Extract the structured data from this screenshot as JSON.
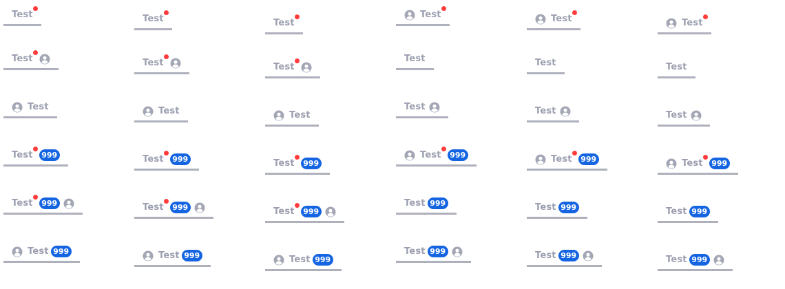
{
  "theme": {
    "inactive_color": "#9b9faf",
    "underline_color": "#aeb0bc",
    "badge_color": "#1565e2",
    "dot_color": "#ff3b3b"
  },
  "tabs": [
    {
      "label": "Test",
      "dot": true
    },
    {
      "label": "Test",
      "dot": true
    },
    {
      "label": "Test",
      "dot": true
    },
    {
      "label": "Test",
      "dot": true,
      "icon": "user-icon",
      "icon_pos": "before"
    },
    {
      "label": "Test",
      "dot": true,
      "icon": "user-icon",
      "icon_pos": "before"
    },
    {
      "label": "Test",
      "dot": true,
      "icon": "user-icon",
      "icon_pos": "before"
    },
    {
      "label": "Test",
      "dot": true,
      "icon": "user-icon",
      "icon_pos": "after"
    },
    {
      "label": "Test",
      "dot": true,
      "icon": "user-icon",
      "icon_pos": "after"
    },
    {
      "label": "Test",
      "dot": true,
      "icon": "user-icon",
      "icon_pos": "after"
    },
    {
      "label": "Test"
    },
    {
      "label": "Test"
    },
    {
      "label": "Test"
    },
    {
      "label": "Test",
      "icon": "user-icon",
      "icon_pos": "before"
    },
    {
      "label": "Test",
      "icon": "user-icon",
      "icon_pos": "before"
    },
    {
      "label": "Test",
      "icon": "user-icon",
      "icon_pos": "before"
    },
    {
      "label": "Test",
      "icon": "user-icon",
      "icon_pos": "after"
    },
    {
      "label": "Test",
      "icon": "user-icon",
      "icon_pos": "after"
    },
    {
      "label": "Test",
      "icon": "user-icon",
      "icon_pos": "after"
    },
    {
      "label": "Test",
      "dot": true,
      "badge": "999"
    },
    {
      "label": "Test",
      "dot": true,
      "badge": "999"
    },
    {
      "label": "Test",
      "dot": true,
      "badge": "999"
    },
    {
      "label": "Test",
      "dot": true,
      "badge": "999",
      "icon": "user-icon",
      "icon_pos": "before"
    },
    {
      "label": "Test",
      "dot": true,
      "badge": "999",
      "icon": "user-icon",
      "icon_pos": "before"
    },
    {
      "label": "Test",
      "dot": true,
      "badge": "999",
      "icon": "user-icon",
      "icon_pos": "before"
    },
    {
      "label": "Test",
      "dot": true,
      "badge": "999",
      "icon": "user-icon",
      "icon_pos": "after"
    },
    {
      "label": "Test",
      "dot": true,
      "badge": "999",
      "icon": "user-icon",
      "icon_pos": "after"
    },
    {
      "label": "Test",
      "dot": true,
      "badge": "999",
      "icon": "user-icon",
      "icon_pos": "after"
    },
    {
      "label": "Test",
      "badge": "999"
    },
    {
      "label": "Test",
      "badge": "999"
    },
    {
      "label": "Test",
      "badge": "999"
    },
    {
      "label": "Test",
      "badge": "999",
      "icon": "user-icon",
      "icon_pos": "before"
    },
    {
      "label": "Test",
      "badge": "999",
      "icon": "user-icon",
      "icon_pos": "before"
    },
    {
      "label": "Test",
      "badge": "999",
      "icon": "user-icon",
      "icon_pos": "before"
    },
    {
      "label": "Test",
      "badge": "999",
      "icon": "user-icon",
      "icon_pos": "after"
    },
    {
      "label": "Test",
      "badge": "999",
      "icon": "user-icon",
      "icon_pos": "after"
    },
    {
      "label": "Test",
      "badge": "999",
      "icon": "user-icon",
      "icon_pos": "after"
    }
  ]
}
